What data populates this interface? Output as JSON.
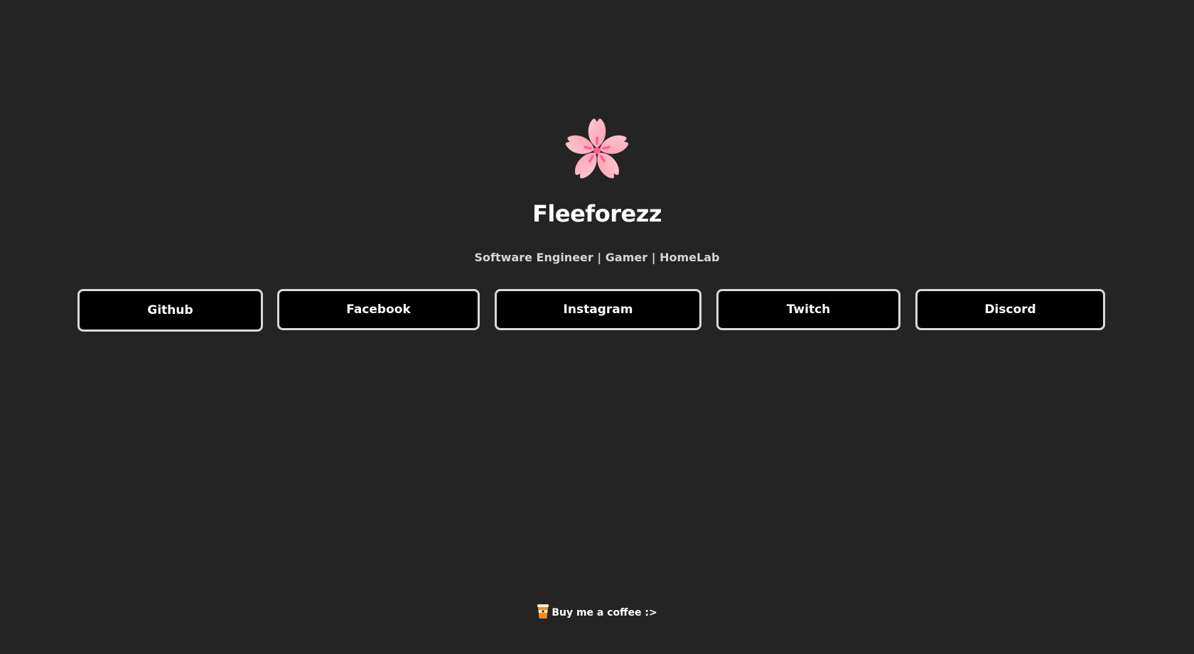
{
  "profile": {
    "avatar_icon": "cherry-blossom-icon",
    "name": "Fleeforezz",
    "tagline": "Software Engineer | Gamer | HomeLab"
  },
  "links": [
    {
      "label": "Github"
    },
    {
      "label": "Facebook"
    },
    {
      "label": "Instagram"
    },
    {
      "label": "Twitch"
    },
    {
      "label": "Discord"
    }
  ],
  "footer": {
    "coffee_icon": "coffee-cup-icon",
    "coffee_label": "Buy me a coffee :>"
  },
  "colors": {
    "background": "#242424",
    "button_bg": "#000000",
    "button_border": "#d9d9d9",
    "blossom_light": "#ffc4cf",
    "blossom_dark": "#ff9fb3",
    "blossom_accent": "#ff5f8f"
  }
}
